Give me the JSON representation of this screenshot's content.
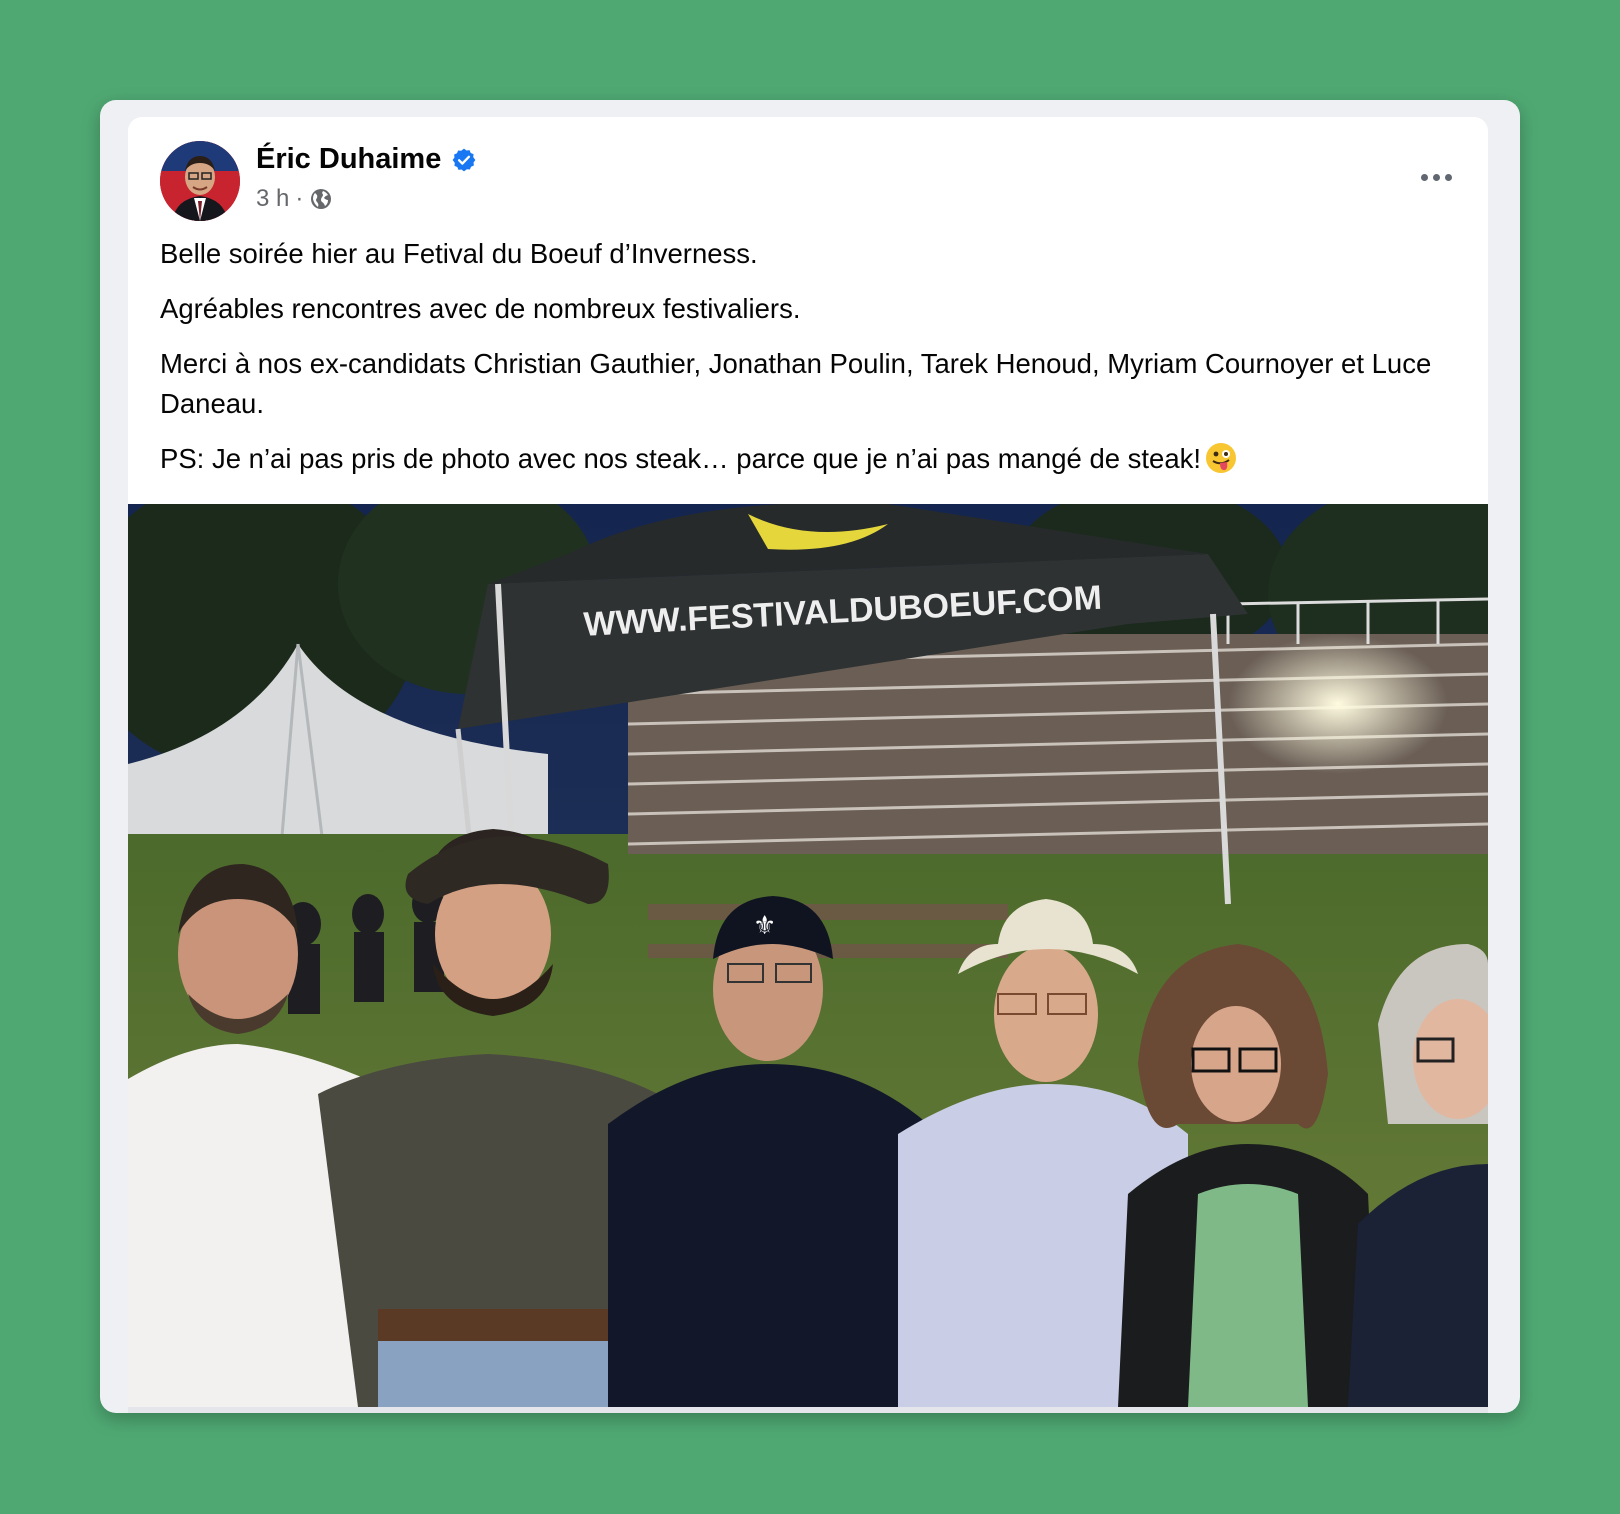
{
  "post": {
    "author_name": "Éric Duhaime",
    "timestamp": "3 h",
    "separator": "·",
    "paragraphs": [
      "Belle soirée hier au Fetival du Boeuf d’Inverness.",
      "Agréables rencontres avec de nombreux festivaliers.",
      "Merci à nos ex-candidats Christian Gauthier, Jonathan Poulin, Tarek Henoud, Myriam Cournoyer et Luce Daneau.",
      "PS: Je n’ai pas pris de photo avec nos steak… parce que je n’ai pas mangé de steak!"
    ],
    "emoji": "winking-face-with-tongue",
    "photo": {
      "tent_text": "WWW.FESTIVALDUBOEUF.COM",
      "cap_logo": "fleur-de-lis"
    }
  },
  "icons": {
    "verified": "verified-badge-icon",
    "audience": "globe-icon",
    "more": "more-options-icon"
  },
  "colors": {
    "background": "#4fa872",
    "verified_blue": "#1877f2",
    "secondary_text": "#65676b"
  }
}
